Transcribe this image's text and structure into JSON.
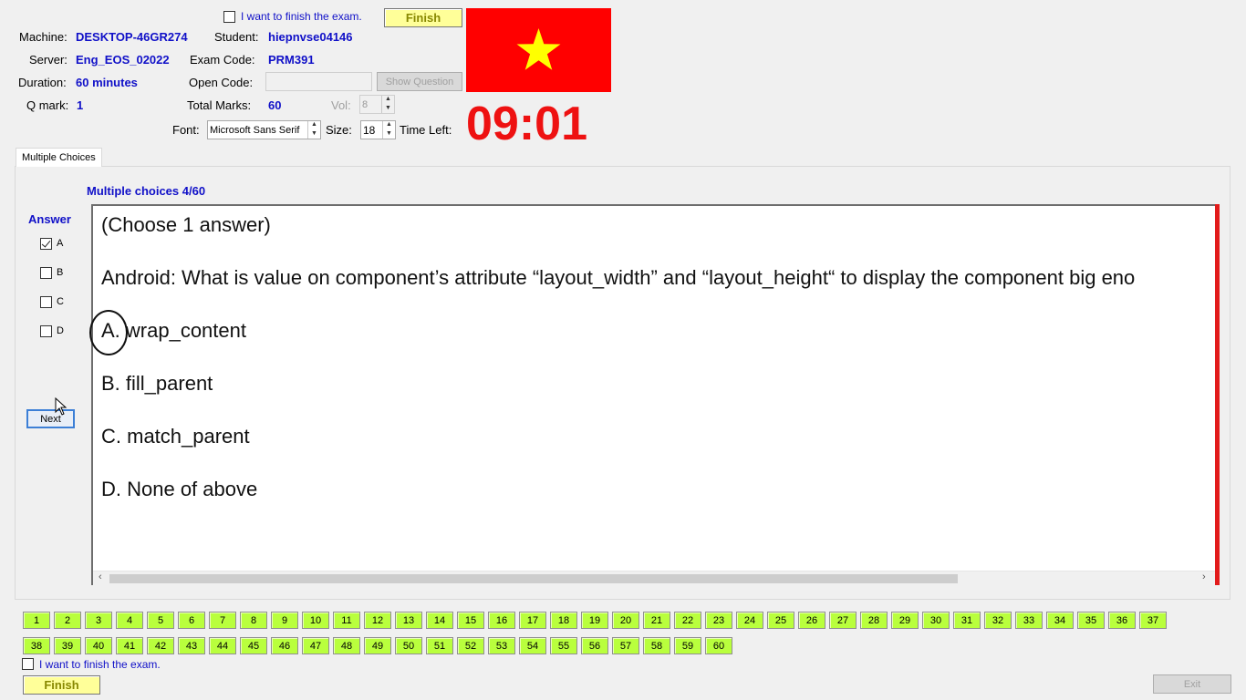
{
  "header": {
    "finish_check_label": "I want to finish the exam.",
    "finish_button": "Finish",
    "machine_label": "Machine:",
    "machine_value": "DESKTOP-46GR274",
    "student_label": "Student:",
    "student_value": "hiepnvse04146",
    "server_label": "Server:",
    "server_value": "Eng_EOS_02022",
    "exam_code_label": "Exam Code:",
    "exam_code_value": "PRM391",
    "duration_label": "Duration:",
    "duration_value": "60 minutes",
    "open_code_label": "Open Code:",
    "open_code_value": "",
    "show_question_button": "Show Question",
    "qmark_label": "Q mark:",
    "qmark_value": "1",
    "total_marks_label": "Total Marks:",
    "total_marks_value": "60",
    "vol_label": "Vol:",
    "vol_value": "8",
    "font_label": "Font:",
    "font_value": "Microsoft Sans Serif",
    "size_label": "Size:",
    "size_value": "18",
    "time_left_label": "Time Left:",
    "timer": "09:01",
    "flag_colors": {
      "field": "#ff0000",
      "star": "#ffff00"
    }
  },
  "tab": {
    "label": "Multiple Choices"
  },
  "question": {
    "counter": "Multiple choices 4/60",
    "answer_heading": "Answer",
    "answer_options": [
      {
        "label": "A",
        "checked": true
      },
      {
        "label": "B",
        "checked": false
      },
      {
        "label": "C",
        "checked": false
      },
      {
        "label": "D",
        "checked": false
      }
    ],
    "next_button": "Next",
    "lines": [
      "(Choose 1 answer)",
      "Android: What is value on component’s attribute “layout_width” and “layout_height“ to display the component big eno",
      "A.  wrap_content",
      "B.  fill_parent",
      "C.  match_parent",
      "D.  None of above"
    ]
  },
  "navigator": {
    "numbers": [
      "1",
      "2",
      "3",
      "4",
      "5",
      "6",
      "7",
      "8",
      "9",
      "10",
      "11",
      "12",
      "13",
      "14",
      "15",
      "16",
      "17",
      "18",
      "19",
      "20",
      "21",
      "22",
      "23",
      "24",
      "25",
      "26",
      "27",
      "28",
      "29",
      "30",
      "31",
      "32",
      "33",
      "34",
      "35",
      "36",
      "37",
      "38",
      "39",
      "40",
      "41",
      "42",
      "43",
      "44",
      "45",
      "46",
      "47",
      "48",
      "49",
      "50",
      "51",
      "52",
      "53",
      "54",
      "55",
      "56",
      "57",
      "58",
      "59",
      "60"
    ]
  },
  "footer": {
    "finish_check_label": "I want to finish the exam.",
    "finish_button": "Finish",
    "exit_button": "Exit"
  }
}
